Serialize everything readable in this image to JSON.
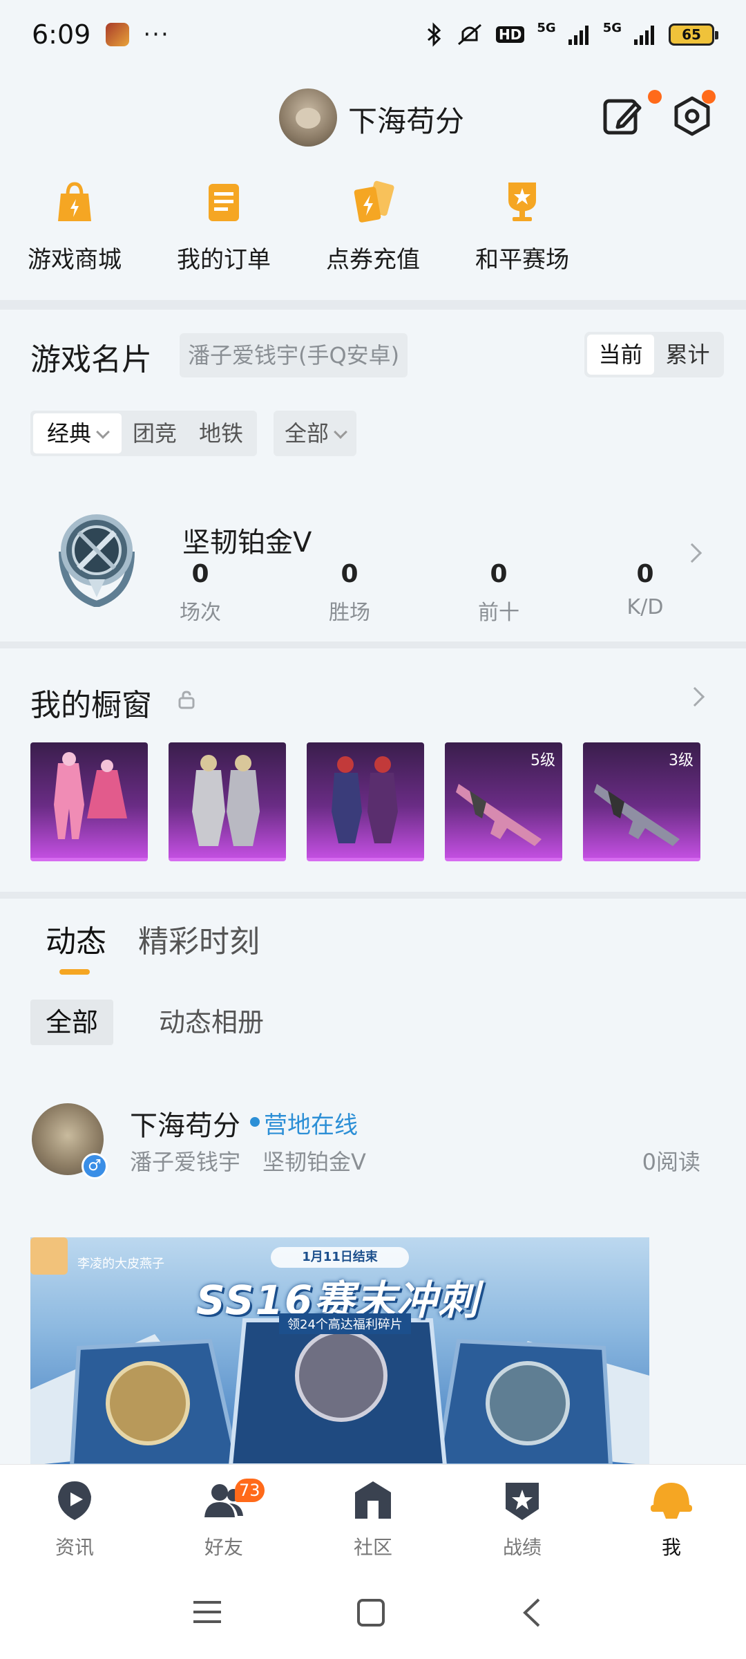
{
  "status_bar": {
    "time": "6:09",
    "dots": "···",
    "network_label_1": "5G",
    "network_label_2": "5G",
    "hd_label": "HD",
    "battery": "65"
  },
  "header": {
    "username": "下海苟分"
  },
  "quick_menu": [
    {
      "label": "游戏商城",
      "icon": "shopping-bag-icon"
    },
    {
      "label": "我的订单",
      "icon": "order-clipboard-icon"
    },
    {
      "label": "点券充值",
      "icon": "coupon-recharge-icon"
    },
    {
      "label": "和平赛场",
      "icon": "trophy-icon"
    }
  ],
  "game_card": {
    "title": "游戏名片",
    "account": "潘子爱钱宇(手Q安卓)",
    "toggle": {
      "current": "当前",
      "cumulative": "累计"
    },
    "filters": {
      "mode": "经典",
      "team": "团竞",
      "metro": "地铁",
      "all": "全部"
    },
    "rank": "坚韧铂金V",
    "stats": [
      {
        "value": "0",
        "label": "场次"
      },
      {
        "value": "0",
        "label": "胜场"
      },
      {
        "value": "0",
        "label": "前十"
      },
      {
        "value": "0",
        "label": "K/D"
      }
    ]
  },
  "showcase": {
    "title": "我的橱窗",
    "items": [
      {
        "level": ""
      },
      {
        "level": ""
      },
      {
        "level": ""
      },
      {
        "level": "5级"
      },
      {
        "level": "3级"
      }
    ]
  },
  "feed": {
    "tabs": [
      "动态",
      "精彩时刻"
    ],
    "subtabs": [
      "全部",
      "动态相册"
    ],
    "post": {
      "author": "下海苟分",
      "online": "营地在线",
      "account": "潘子爱钱宇",
      "rank": "坚韧铂金V",
      "reads": "0阅读",
      "gender": "♂",
      "banner": {
        "author": "李凌的大皮燕子",
        "date": "1月11日结束",
        "title": "SS16赛末冲刺",
        "subtitle": "领24个高达福利碎片"
      }
    }
  },
  "bottom_nav": [
    {
      "label": "资讯",
      "icon": "news-play-icon"
    },
    {
      "label": "好友",
      "icon": "friends-icon",
      "badge": "73"
    },
    {
      "label": "社区",
      "icon": "community-icon"
    },
    {
      "label": "战绩",
      "icon": "record-badge-icon"
    },
    {
      "label": "我",
      "icon": "helmet-icon"
    }
  ],
  "colors": {
    "accent": "#f5a623",
    "badge": "#ff6a1a",
    "link": "#2c8fd6",
    "showcase_purple": "#c24fe0"
  }
}
